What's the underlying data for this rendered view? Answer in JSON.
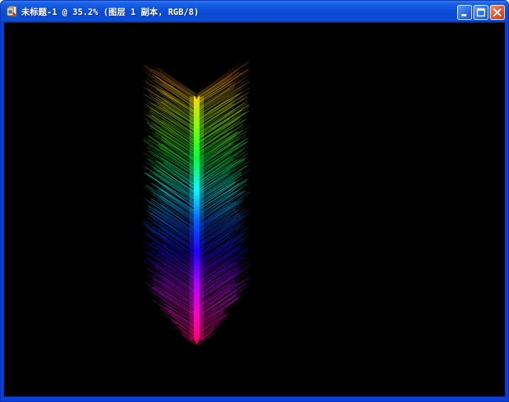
{
  "window": {
    "title": "未标题-1 @ 35.2% (图层 1 副本, RGB/8)",
    "app_icon": "photoshop-document-icon",
    "buttons": {
      "minimize": "minimize-icon",
      "maximize": "maximize-icon",
      "close": "close-icon"
    }
  },
  "canvas": {
    "background": "#000000",
    "artwork": "rainbow-feather-arrow",
    "spectrum": [
      "#ff6a00",
      "#ffd800",
      "#7cff00",
      "#00ff40",
      "#00ffff",
      "#0060ff",
      "#2000ff",
      "#b000ff",
      "#ff00c8",
      "#ff0060"
    ]
  },
  "colors": {
    "title_bar": "#0a49d0",
    "close_button": "#e25a33"
  }
}
